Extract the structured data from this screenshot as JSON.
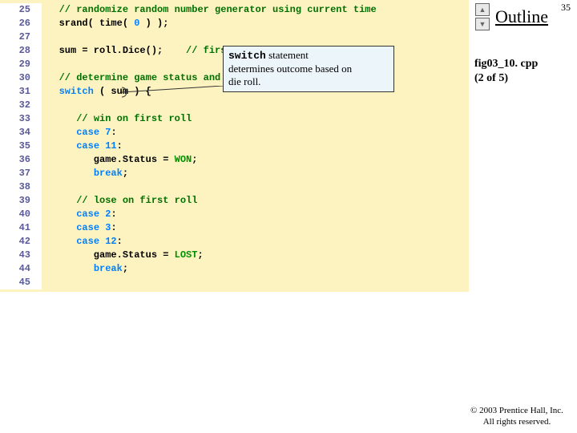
{
  "pagenum": "35",
  "outline": "Outline",
  "fig": "fig03_10. cpp",
  "figpart": "(2 of 5)",
  "copyright": "© 2003 Prentice Hall, Inc.",
  "rights": "All rights reserved.",
  "callout": {
    "kw": "switch",
    "rest1": " statement",
    "rest2": "determines outcome based on",
    "rest3": "die roll."
  },
  "lines": {
    "l25n": "25",
    "l25a": "   ",
    "l25b": "// randomize random number generator using current time",
    "l26n": "26",
    "l26a": "   srand( time( ",
    "l26b": "0",
    "l26c": " ) );",
    "l27n": "27",
    "l27a": "",
    "l28n": "28",
    "l28a": "   sum = roll.Dice();    ",
    "l28b": "// first",
    "l29n": "29",
    "l29a": "",
    "l30n": "30",
    "l30a": "   ",
    "l30b": "// determine game status and",
    "l30c": " die roll.",
    "l31n": "31",
    "l31a": "   ",
    "l31b": "switch",
    "l31c": " ( sum ) {",
    "l32n": "32",
    "l32a": "",
    "l33n": "33",
    "l33a": "      ",
    "l33b": "// win on first roll",
    "l34n": "34",
    "l34a": "      ",
    "l34b": "case",
    "l34c": " ",
    "l34d": "7",
    "l34e": ":",
    "l35n": "35",
    "l35a": "      ",
    "l35b": "case",
    "l35c": " ",
    "l35d": "11",
    "l35e": ":",
    "l36n": "36",
    "l36a": "         game.Status = ",
    "l36b": "WON",
    "l36c": ";",
    "l37n": "37",
    "l37a": "         ",
    "l37b": "break",
    "l37c": ";",
    "l38n": "38",
    "l38a": "",
    "l39n": "39",
    "l39a": "      ",
    "l39b": "// lose on first roll",
    "l40n": "40",
    "l40a": "      ",
    "l40b": "case",
    "l40c": " ",
    "l40d": "2",
    "l40e": ":",
    "l41n": "41",
    "l41a": "      ",
    "l41b": "case",
    "l41c": " ",
    "l41d": "3",
    "l41e": ":",
    "l42n": "42",
    "l42a": "      ",
    "l42b": "case",
    "l42c": " ",
    "l42d": "12",
    "l42e": ":",
    "l43n": "43",
    "l43a": "         game.Status = ",
    "l43b": "LOST",
    "l43c": ";",
    "l44n": "44",
    "l44a": "         ",
    "l44b": "break",
    "l44c": ";",
    "l45n": "45",
    "l45a": ""
  }
}
